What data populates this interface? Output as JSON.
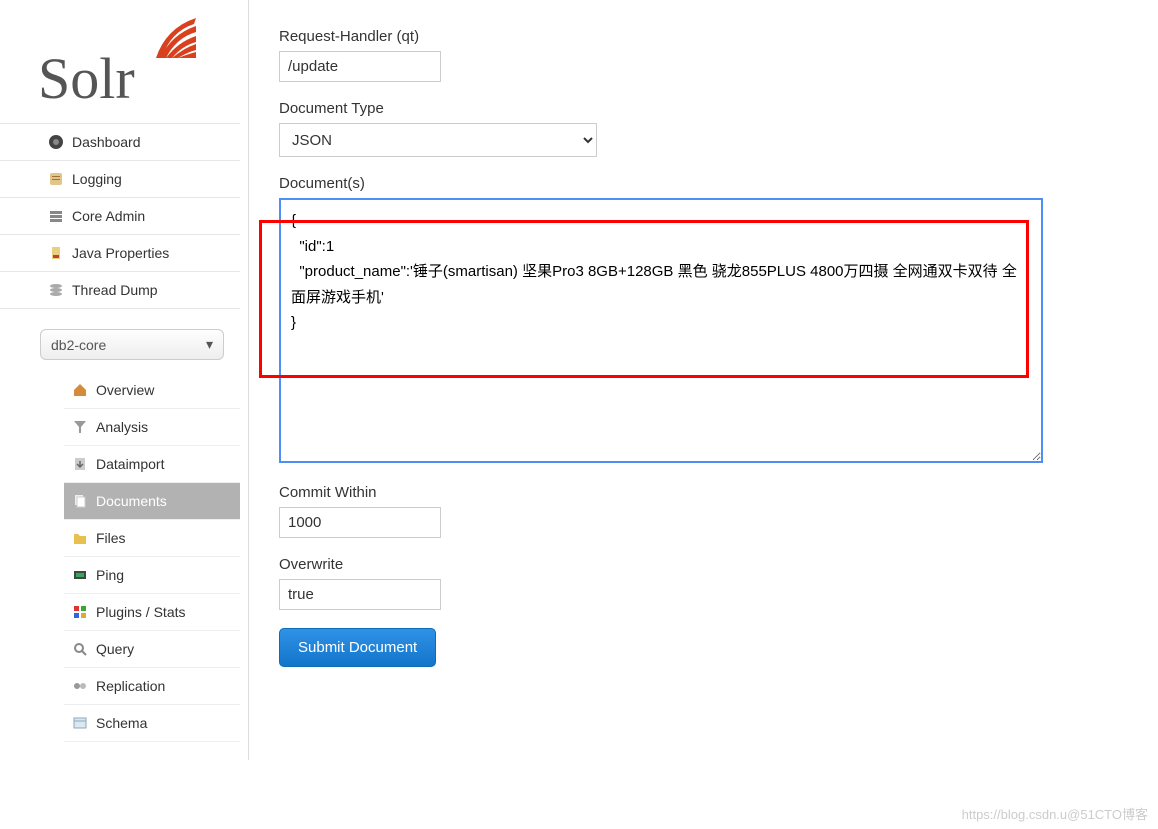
{
  "logo_text": "Solr",
  "nav": [
    {
      "label": "Dashboard",
      "icon": "dashboard"
    },
    {
      "label": "Logging",
      "icon": "logging"
    },
    {
      "label": "Core Admin",
      "icon": "coreadmin"
    },
    {
      "label": "Java Properties",
      "icon": "javaprops"
    },
    {
      "label": "Thread Dump",
      "icon": "threaddump"
    }
  ],
  "core_selector": {
    "selected": "db2-core"
  },
  "subnav": [
    {
      "label": "Overview",
      "icon": "overview",
      "active": false
    },
    {
      "label": "Analysis",
      "icon": "analysis",
      "active": false
    },
    {
      "label": "Dataimport",
      "icon": "dataimport",
      "active": false
    },
    {
      "label": "Documents",
      "icon": "documents",
      "active": true
    },
    {
      "label": "Files",
      "icon": "files",
      "active": false
    },
    {
      "label": "Ping",
      "icon": "ping",
      "active": false
    },
    {
      "label": "Plugins / Stats",
      "icon": "plugins",
      "active": false
    },
    {
      "label": "Query",
      "icon": "query",
      "active": false
    },
    {
      "label": "Replication",
      "icon": "replication",
      "active": false
    },
    {
      "label": "Schema",
      "icon": "schema",
      "active": false
    }
  ],
  "form": {
    "request_handler": {
      "label": "Request-Handler (qt)",
      "value": "/update"
    },
    "document_type": {
      "label": "Document Type",
      "value": "JSON"
    },
    "documents": {
      "label": "Document(s)",
      "value": "{\n  \"id\":1\n  \"product_name\":'锤子(smartisan) 坚果Pro3 8GB+128GB 黑色 骁龙855PLUS 4800万四摄 全网通双卡双待 全面屏游戏手机'\n}"
    },
    "commit_within": {
      "label": "Commit Within",
      "value": "1000"
    },
    "overwrite": {
      "label": "Overwrite",
      "value": "true"
    },
    "submit_label": "Submit Document"
  },
  "watermark": "https://blog.csdn.u@51CTO博客"
}
